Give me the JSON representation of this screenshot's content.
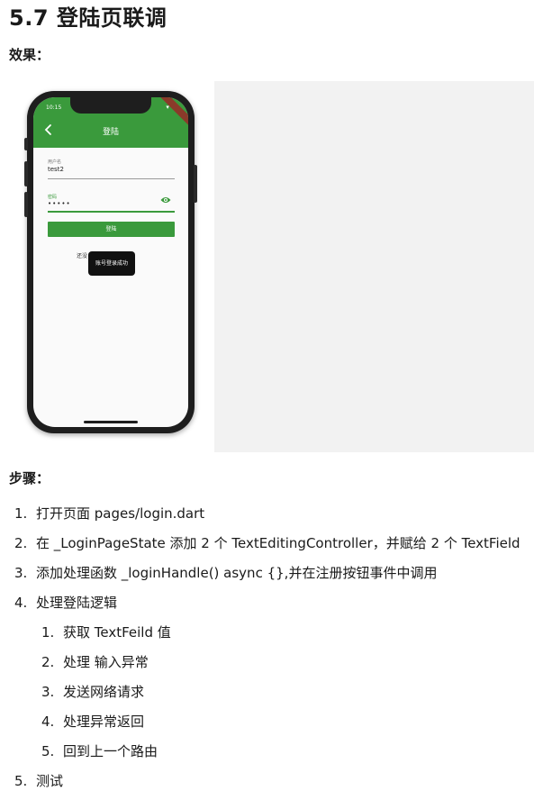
{
  "title": "5.7 登陆页联调",
  "effect_heading": "效果：",
  "steps_heading": "步骤：",
  "phone": {
    "status_time": "10:15",
    "status_icons": "▾ ▮",
    "appbar_title": "登陆",
    "username_label": "用户名",
    "username_value": "test2",
    "password_label": "密码",
    "password_value": "•••••",
    "login_button": "登陆",
    "register_text": "还没",
    "toast": "账号登录成功"
  },
  "steps": [
    {
      "num": "1.",
      "text": "打开页面 pages/login.dart"
    },
    {
      "num": "2.",
      "text": "在 _LoginPageState 添加 2 个 TextEditingController，并赋给 2 个 TextField"
    },
    {
      "num": "3.",
      "text": "添加处理函数 _loginHandle() async {},并在注册按钮事件中调用"
    },
    {
      "num": "4.",
      "text": "处理登陆逻辑"
    }
  ],
  "sub_steps": [
    {
      "num": "1.",
      "text": "获取 TextFeild 值"
    },
    {
      "num": "2.",
      "text": "处理 输入异常"
    },
    {
      "num": "3.",
      "text": "发送网络请求"
    },
    {
      "num": "4.",
      "text": "处理异常返回"
    },
    {
      "num": "5.",
      "text": "回到上一个路由"
    }
  ],
  "last_step": {
    "num": "5.",
    "text": "测试"
  },
  "colors": {
    "accent": "#3a9a3c",
    "toast_bg": "#111111",
    "placeholder_panel": "#f2f2f2"
  }
}
